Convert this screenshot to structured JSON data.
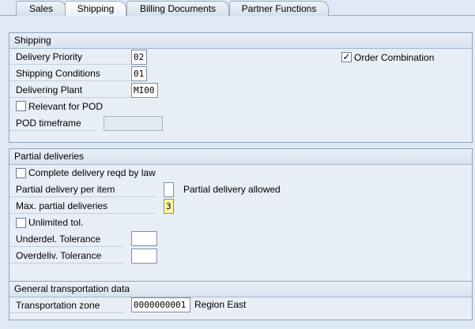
{
  "tabs": [
    "Sales",
    "Shipping",
    "Billing Documents",
    "Partner Functions"
  ],
  "shipping": {
    "title": "Shipping",
    "delivery_priority_label": "Delivery Priority",
    "delivery_priority_value": "02",
    "shipping_conditions_label": "Shipping Conditions",
    "shipping_conditions_value": "01",
    "delivering_plant_label": "Delivering Plant",
    "delivering_plant_value": "MI00",
    "relevant_pod_label": "Relevant for POD",
    "pod_timeframe_label": "POD timeframe",
    "pod_timeframe_value": "",
    "order_combination_label": "Order Combination",
    "order_combination_checked": true
  },
  "partial": {
    "title": "Partial deliveries",
    "complete_delivery_label": "Complete delivery reqd by law",
    "per_item_label": "Partial delivery per item",
    "per_item_value": "",
    "per_item_desc": "Partial delivery allowed",
    "max_partial_label": "Max. partial deliveries",
    "max_partial_value": "3",
    "unlimited_tol_label": "Unlimited tol.",
    "underdel_label": "Underdel. Tolerance",
    "underdel_value": "",
    "overdeliv_label": "Overdeliv. Tolerance",
    "overdeliv_value": ""
  },
  "transport": {
    "title": "General transportation data",
    "zone_label": "Transportation zone",
    "zone_value": "0000000001",
    "zone_desc": "Region East"
  },
  "icons": {
    "checkmark": "checkmark-icon"
  }
}
